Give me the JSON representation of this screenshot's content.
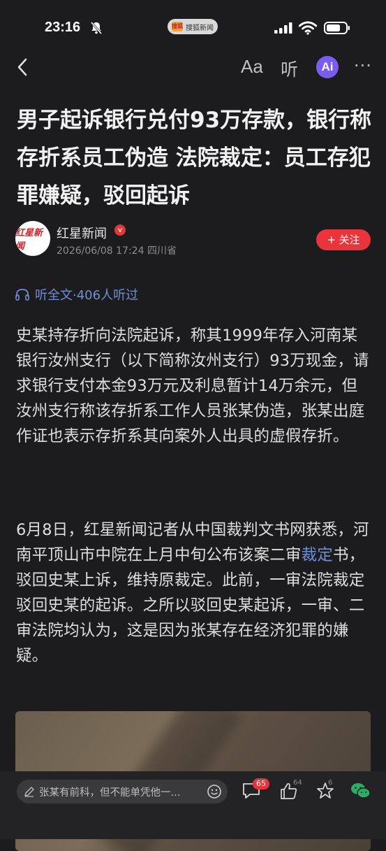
{
  "status_bar": {
    "time": "23:16",
    "pill_logo": "搜狐",
    "pill_text": "搜狐新闻"
  },
  "nav": {
    "font_label": "Aa",
    "listen_label": "听",
    "ai_label": "Ai",
    "more_label": "···"
  },
  "article": {
    "headline": "男子起诉银行兑付93万存款，银行称存折系员工伪造 法院裁定：员工存犯罪嫌疑，驳回起诉",
    "author": "红星新闻",
    "verified_mark": "v",
    "avatar_text": "红星新闻",
    "date": "2026/06/08 17:24",
    "location": "四川省",
    "follow_label": "+ 关注",
    "listen_text": "听全文·406人听过",
    "p1": "史某持存折向法院起诉，称其1999年存入河南某银行汝州支行（以下简称汝州支行）93万现金，请求银行支付本金93万元及利息暂计14万余元，但汝州支行称该存折系工作人员张某伪造，张某出庭作证也表示存折系其向案外人出具的虚假存折。",
    "p2_a": "6月8日，红星新闻记者从中国裁判文书网获悉，河南平顶山市中院在上月中旬公布该案二审",
    "p2_link": "裁定",
    "p2_b": "书，驳回史某上诉，维持原裁定。此前，一审法院裁定驳回史某的起诉。之所以驳回史某起诉，一审、二审法院均认为，这是因为张某存在经济犯罪的嫌疑。"
  },
  "bottom_bar": {
    "comment_placeholder": "张某有前科，但不能单凭他一...",
    "comment_count": "65",
    "like_count": "64",
    "star_count": "6"
  },
  "colors": {
    "accent_red": "#e8343a",
    "link_blue": "#6f8fd6",
    "ai_purple": "#7b5cf0",
    "wechat_green": "#2aae67"
  }
}
